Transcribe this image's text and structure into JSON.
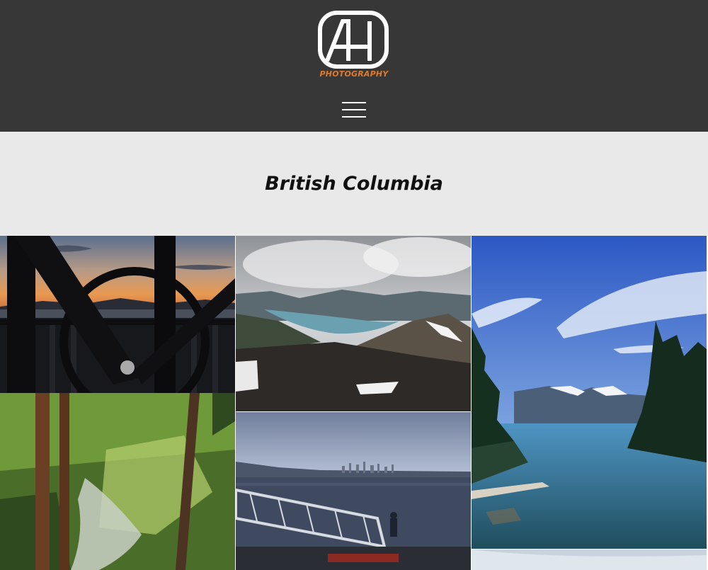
{
  "header": {
    "logo_text": "AH",
    "logo_tagline": "PHOTOGRAPHY",
    "accent_color": "#e07a2c",
    "menu_icon": "hamburger-menu-icon"
  },
  "page": {
    "title": "British Columbia"
  },
  "gallery": {
    "photos": [
      {
        "subject": "sunset-through-wagon-wheel"
      },
      {
        "subject": "mountain-lake-overlook"
      },
      {
        "subject": "alpine-lake-under-blue-sky"
      },
      {
        "subject": "forest-and-waterfall"
      },
      {
        "subject": "city-skyline-across-harbour"
      },
      {
        "subject": "next-photo-partial"
      }
    ]
  },
  "colors": {
    "header_bg": "#373737",
    "title_band_bg": "#e9e9e9"
  }
}
